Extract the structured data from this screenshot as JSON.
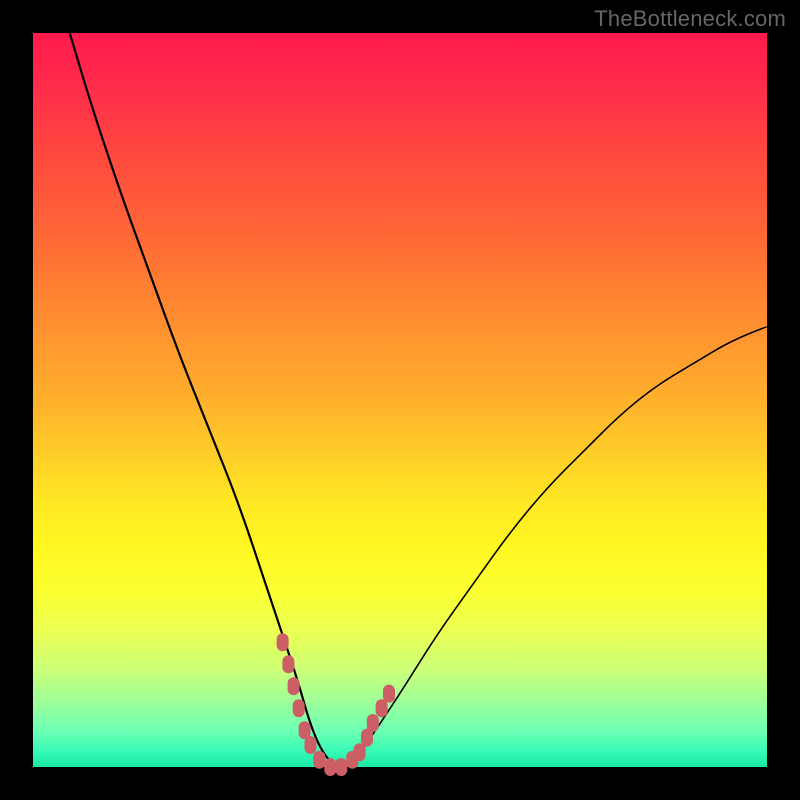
{
  "watermark": {
    "text": "TheBottleneck.com"
  },
  "colors": {
    "frame": "#000000",
    "curve": "#000000",
    "marker": "#cc5f66"
  },
  "chart_data": {
    "type": "line",
    "title": "",
    "xlabel": "",
    "ylabel": "",
    "xlim": [
      0,
      100
    ],
    "ylim": [
      0,
      100
    ],
    "grid": false,
    "legend": false,
    "description": "Bottleneck curve: y represents bottleneck % vs. a ratio on x. Curve descends from top-left, reaches zero near x≈40, then rises to the right. Pink markers cluster near the trough.",
    "series": [
      {
        "name": "bottleneck-curve",
        "x": [
          5,
          8,
          12,
          16,
          20,
          24,
          28,
          32,
          34,
          36,
          38,
          40,
          42,
          44,
          46,
          50,
          55,
          60,
          65,
          70,
          75,
          80,
          85,
          90,
          95,
          100
        ],
        "y": [
          100,
          90,
          78,
          67,
          56,
          46,
          36,
          24,
          18,
          12,
          5,
          1,
          0,
          1,
          4,
          10,
          18,
          25,
          32,
          38,
          43,
          48,
          52,
          55,
          58,
          60
        ]
      }
    ],
    "markers": [
      {
        "x": 34.0,
        "y": 17
      },
      {
        "x": 34.8,
        "y": 14
      },
      {
        "x": 35.5,
        "y": 11
      },
      {
        "x": 36.2,
        "y": 8
      },
      {
        "x": 37.0,
        "y": 5
      },
      {
        "x": 37.8,
        "y": 3
      },
      {
        "x": 39.0,
        "y": 1
      },
      {
        "x": 40.5,
        "y": 0
      },
      {
        "x": 42.0,
        "y": 0
      },
      {
        "x": 43.5,
        "y": 1
      },
      {
        "x": 44.5,
        "y": 2
      },
      {
        "x": 45.5,
        "y": 4
      },
      {
        "x": 46.3,
        "y": 6
      },
      {
        "x": 47.5,
        "y": 8
      },
      {
        "x": 48.5,
        "y": 10
      }
    ]
  }
}
